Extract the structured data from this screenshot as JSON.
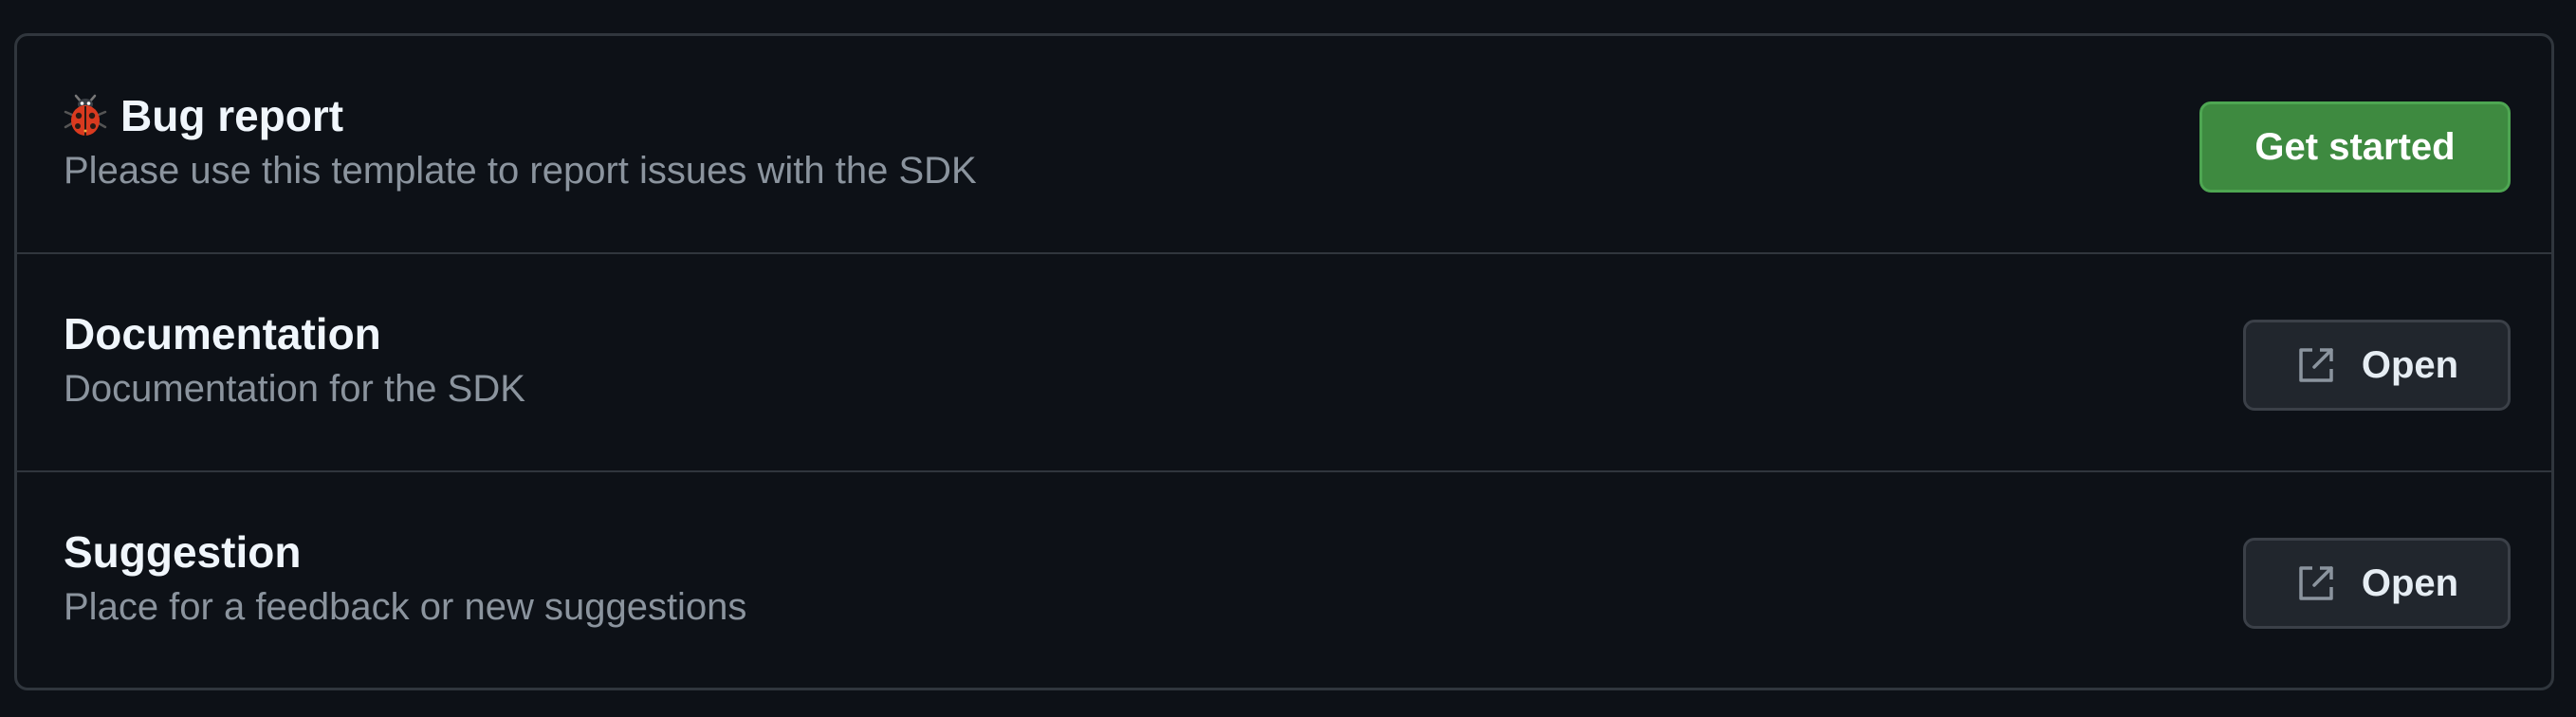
{
  "templates": [
    {
      "title": "Bug report",
      "description": "Please use this template to report issues with the SDK",
      "icon": "ladybug-icon",
      "button_label": "Get started",
      "button_style": "primary"
    },
    {
      "title": "Documentation",
      "description": "Documentation for the SDK",
      "button_label": "Open",
      "button_icon": "link-external-icon"
    },
    {
      "title": "Suggestion",
      "description": "Place for a feedback or new suggestions",
      "button_label": "Open",
      "button_icon": "link-external-icon"
    }
  ],
  "colors": {
    "background": "#0d1117",
    "border": "#30363d",
    "title": "#f0f6fc",
    "description": "#8b949e",
    "primary_button": "#3e8a40",
    "secondary_button": "#21262d"
  }
}
